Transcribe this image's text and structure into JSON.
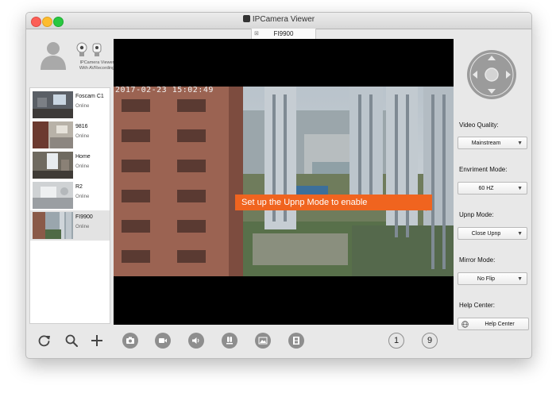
{
  "window": {
    "title": "IPCamera Viewer"
  },
  "tab": {
    "label": "FI9900"
  },
  "profile": {
    "line1": "IPCamera Viewer",
    "line2": "With AVRecording"
  },
  "devices": [
    {
      "name": "Foscam C1",
      "status": "Online"
    },
    {
      "name": "9816",
      "status": "Online"
    },
    {
      "name": "Home",
      "status": "Online"
    },
    {
      "name": "R2",
      "status": "Online"
    },
    {
      "name": "FI9900",
      "status": "Online",
      "selected": true
    }
  ],
  "video": {
    "timestamp": "2017-02-23 15:02:49",
    "callout": "Set up the Upnp Mode to enable"
  },
  "controls": {
    "video_quality": {
      "label": "Video Quality:",
      "value": "Mainstream"
    },
    "environment_mode": {
      "label": "Envriment Mode:",
      "value": "60 HZ"
    },
    "upnp_mode": {
      "label": "Upnp Mode:",
      "value": "Close Upnp"
    },
    "mirror_mode": {
      "label": "Mirror Mode:",
      "value": "No Flip"
    },
    "help_center": {
      "label": "Help Center:",
      "button": "Help Center"
    }
  },
  "toolbar": {
    "left": [
      "refresh-icon",
      "search-icon",
      "add-icon"
    ],
    "center": [
      "camera-icon",
      "record-icon",
      "speaker-icon",
      "talk-icon",
      "image-icon",
      "film-icon"
    ],
    "layout_1": "1",
    "layout_9": "9"
  },
  "colors": {
    "accent": "#f0641f",
    "window_bg": "#e8e8e8",
    "video_bg": "#000000",
    "traffic_red": "#fc5f57",
    "traffic_yellow": "#fdbc2e",
    "traffic_green": "#28c840"
  }
}
